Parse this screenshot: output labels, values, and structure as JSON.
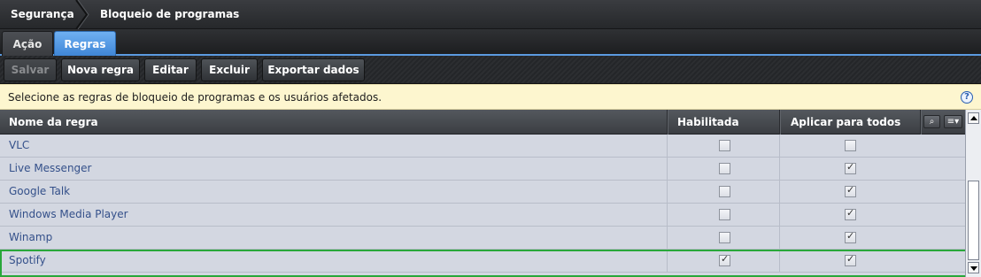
{
  "breadcrumb": {
    "root": "Segurança",
    "current": "Bloqueio de programas"
  },
  "tabs": [
    {
      "label": "Ação",
      "active": false
    },
    {
      "label": "Regras",
      "active": true
    }
  ],
  "toolbar": {
    "save": "Salvar",
    "new_rule": "Nova regra",
    "edit": "Editar",
    "delete": "Excluir",
    "export": "Exportar dados"
  },
  "info": {
    "text": "Selecione as regras de bloqueio de programas e os usuários afetados.",
    "help_glyph": "?"
  },
  "grid": {
    "columns": {
      "name": "Nome da regra",
      "enabled": "Habilitada",
      "apply_all": "Aplicar para todos"
    },
    "search_glyph": "⌕",
    "menu_glyph": "≡▾",
    "rows": [
      {
        "name": "VLC",
        "enabled": false,
        "apply_all": false,
        "selected": false
      },
      {
        "name": "Live Messenger",
        "enabled": false,
        "apply_all": true,
        "selected": false
      },
      {
        "name": "Google Talk",
        "enabled": false,
        "apply_all": true,
        "selected": false
      },
      {
        "name": "Windows Media Player",
        "enabled": false,
        "apply_all": true,
        "selected": false
      },
      {
        "name": "Winamp",
        "enabled": false,
        "apply_all": true,
        "selected": false
      },
      {
        "name": "Spotify",
        "enabled": true,
        "apply_all": true,
        "selected": true
      }
    ]
  },
  "colors": {
    "accent": "#4a90e2",
    "selection_border": "#29a73a",
    "info_bg": "#fdf6cf"
  }
}
